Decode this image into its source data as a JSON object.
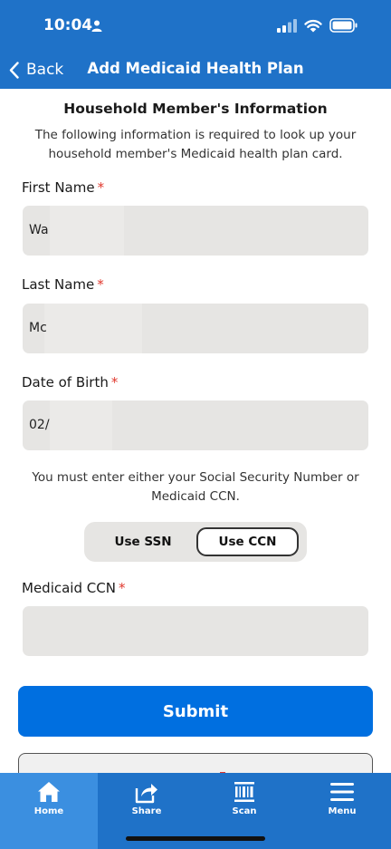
{
  "status": {
    "time": "10:04"
  },
  "nav": {
    "back_label": "Back",
    "title": "Add Medicaid Health Plan"
  },
  "section": {
    "title": "Household Member's Information",
    "intro": "The following information is required to look up your household member's Medicaid health plan card."
  },
  "fields": {
    "first_name": {
      "label": "First Name",
      "required": "*",
      "value": "Wa"
    },
    "last_name": {
      "label": "Last Name",
      "required": "*",
      "value": "Mc"
    },
    "dob": {
      "label": "Date of Birth",
      "required": "*",
      "value": "02/"
    },
    "ccn": {
      "label": "Medicaid CCN",
      "required": "*",
      "value": ""
    }
  },
  "notice": "You must enter either your Social Security Number or Medicaid CCN.",
  "id_toggle": {
    "options": [
      "Use SSN",
      "Use CCN"
    ],
    "selected": "Use CCN"
  },
  "submit_label": "Submit",
  "tabbar": {
    "items": [
      {
        "label": "Home",
        "icon": "home-icon",
        "active": true
      },
      {
        "label": "Share",
        "icon": "share-icon"
      },
      {
        "label": "Scan",
        "icon": "barcode-icon"
      },
      {
        "label": "Menu",
        "icon": "menu-icon"
      }
    ]
  },
  "colors": {
    "brand": "#1f72c8",
    "primary_button": "#006fe0",
    "required": "#e0382e",
    "field_bg": "#e6e5e3"
  }
}
